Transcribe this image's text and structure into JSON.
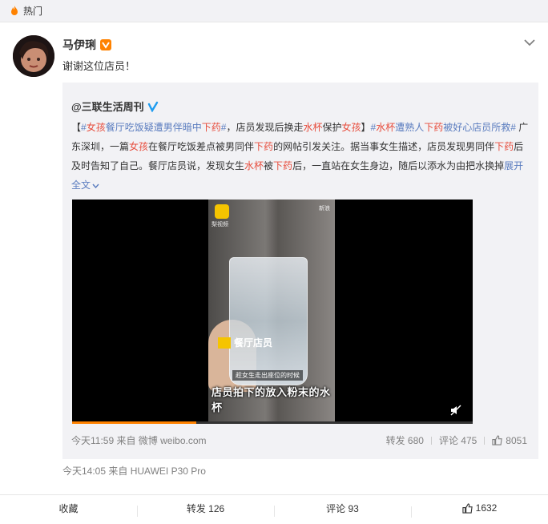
{
  "topbar": {
    "title": "热门",
    "icon": "fire-icon"
  },
  "post": {
    "username": "马伊琍",
    "verified_badge": "vip-badge-icon",
    "text": "谢谢这位店员！",
    "time": "今天14:05",
    "source": "来自 HUAWEI P30 Pro"
  },
  "repost": {
    "author": "@三联生活周刊",
    "segments": [
      {
        "t": "【",
        "c": "plain"
      },
      {
        "t": "#",
        "c": "tag"
      },
      {
        "t": "女孩",
        "c": "hl"
      },
      {
        "t": "餐厅吃饭疑遭",
        "c": "tag"
      },
      {
        "t": "男伴",
        "c": "tag"
      },
      {
        "t": "暗中",
        "c": "tag"
      },
      {
        "t": "下药",
        "c": "hl"
      },
      {
        "t": "#",
        "c": "tag"
      },
      {
        "t": "，店员发现后换走",
        "c": "plain"
      },
      {
        "t": "水杯",
        "c": "hl"
      },
      {
        "t": "保护",
        "c": "plain"
      },
      {
        "t": "女孩",
        "c": "hl"
      },
      {
        "t": "】",
        "c": "plain"
      },
      {
        "t": "#",
        "c": "tag"
      },
      {
        "t": "水杯",
        "c": "hl"
      },
      {
        "t": "遭熟人",
        "c": "tag"
      },
      {
        "t": "下药",
        "c": "hl"
      },
      {
        "t": "被好心店员所救#",
        "c": "tag"
      },
      {
        "t": " 广东深圳，一篇",
        "c": "plain"
      },
      {
        "t": "女孩",
        "c": "hl"
      },
      {
        "t": "在餐厅吃饭差点被男同伴",
        "c": "plain"
      },
      {
        "t": "下药",
        "c": "hl"
      },
      {
        "t": "的网帖引发关注。据当事女生描述，店员发现男同伴",
        "c": "plain"
      },
      {
        "t": "下药",
        "c": "hl"
      },
      {
        "t": "后及时告知了自己。餐厅店员说，发现女生",
        "c": "plain"
      },
      {
        "t": "水杯",
        "c": "hl"
      },
      {
        "t": "被",
        "c": "plain"
      },
      {
        "t": "下药",
        "c": "hl"
      },
      {
        "t": "后，一直站在女生身边，随后以添水为由把水换掉",
        "c": "plain"
      }
    ],
    "expand_label": "展开全文",
    "video": {
      "logo_label": "梨视频",
      "corner_badge": "新浪",
      "speaker_label": "餐厅店员",
      "subtitle_small": "趁女生走出座位的时候",
      "subtitle_big": "店员拍下的放入粉末的水杯",
      "progress": 0.31
    },
    "meta": "今天11:59 来自 微博 weibo.com",
    "forward_label": "转发 680",
    "comment_label": "评论 475",
    "like_count": "8051"
  },
  "actions": {
    "favorite": "收藏",
    "forward": "转发 126",
    "comment": "评论 93",
    "like": "1632"
  },
  "colors": {
    "link": "#5a7cbf",
    "highlight": "#e74c3c",
    "accent": "#ff8200"
  }
}
